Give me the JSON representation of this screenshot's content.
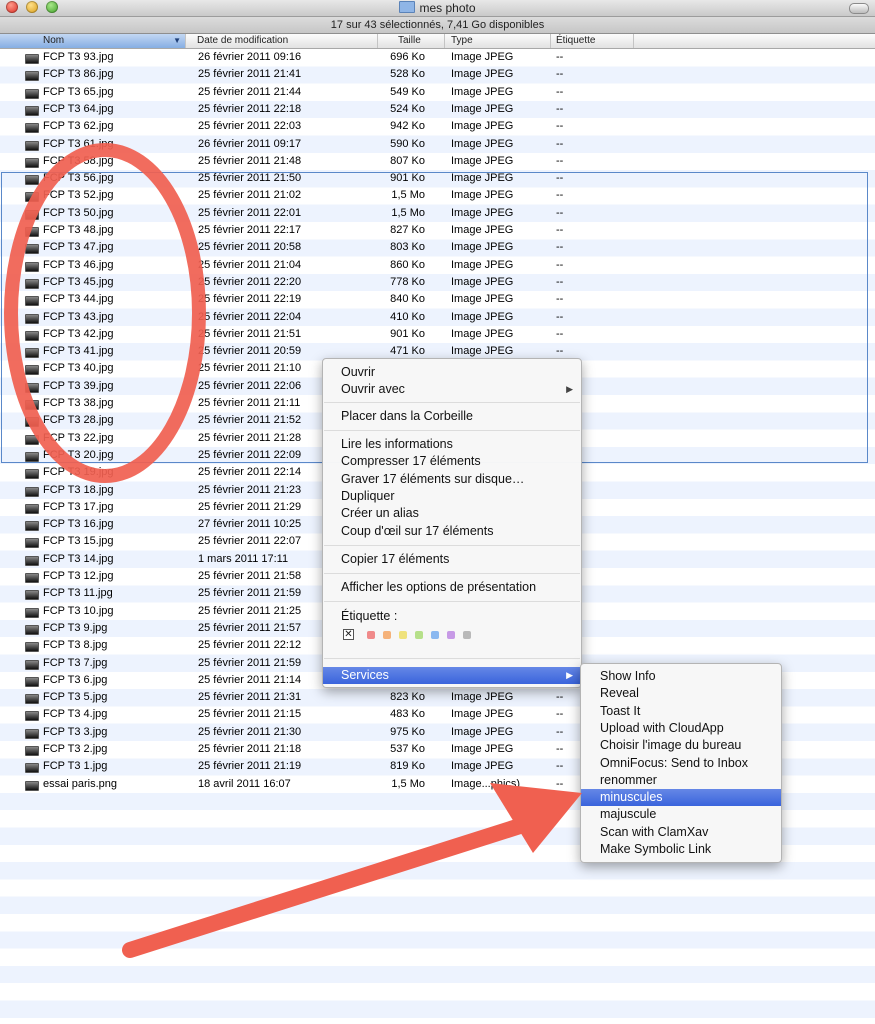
{
  "window": {
    "title": "mes photo",
    "status": "17 sur 43 sélectionnés, 7,41 Go disponibles"
  },
  "columns": {
    "name": "Nom",
    "date": "Date de modification",
    "size": "Taille",
    "type": "Type",
    "label": "Étiquette"
  },
  "files": [
    {
      "name": "FCP T3 93.jpg",
      "date": "26 février 2011 09:16",
      "size": "696 Ko",
      "type": "Image JPEG",
      "label": "--"
    },
    {
      "name": "FCP T3 86.jpg",
      "date": "25 février 2011 21:41",
      "size": "528 Ko",
      "type": "Image JPEG",
      "label": "--"
    },
    {
      "name": "FCP T3 65.jpg",
      "date": "25 février 2011 21:44",
      "size": "549 Ko",
      "type": "Image JPEG",
      "label": "--"
    },
    {
      "name": "FCP T3 64.jpg",
      "date": "25 février 2011 22:18",
      "size": "524 Ko",
      "type": "Image JPEG",
      "label": "--"
    },
    {
      "name": "FCP T3 62.jpg",
      "date": "25 février 2011 22:03",
      "size": "942 Ko",
      "type": "Image JPEG",
      "label": "--"
    },
    {
      "name": "FCP T3 61.jpg",
      "date": "26 février 2011 09:17",
      "size": "590 Ko",
      "type": "Image JPEG",
      "label": "--"
    },
    {
      "name": "FCP T3 58.jpg",
      "date": "25 février 2011 21:48",
      "size": "807 Ko",
      "type": "Image JPEG",
      "label": "--"
    },
    {
      "name": "FCP T3 56.jpg",
      "date": "25 février 2011 21:50",
      "size": "901 Ko",
      "type": "Image JPEG",
      "label": "--"
    },
    {
      "name": "FCP T3 52.jpg",
      "date": "25 février 2011 21:02",
      "size": "1,5 Mo",
      "type": "Image JPEG",
      "label": "--"
    },
    {
      "name": "FCP T3 50.jpg",
      "date": "25 février 2011 22:01",
      "size": "1,5 Mo",
      "type": "Image JPEG",
      "label": "--"
    },
    {
      "name": "FCP T3 48.jpg",
      "date": "25 février 2011 22:17",
      "size": "827 Ko",
      "type": "Image JPEG",
      "label": "--"
    },
    {
      "name": "FCP T3 47.jpg",
      "date": "25 février 2011 20:58",
      "size": "803 Ko",
      "type": "Image JPEG",
      "label": "--"
    },
    {
      "name": "FCP T3 46.jpg",
      "date": "25 février 2011 21:04",
      "size": "860 Ko",
      "type": "Image JPEG",
      "label": "--"
    },
    {
      "name": "FCP T3 45.jpg",
      "date": "25 février 2011 22:20",
      "size": "778 Ko",
      "type": "Image JPEG",
      "label": "--"
    },
    {
      "name": "FCP T3 44.jpg",
      "date": "25 février 2011 22:19",
      "size": "840 Ko",
      "type": "Image JPEG",
      "label": "--"
    },
    {
      "name": "FCP T3 43.jpg",
      "date": "25 février 2011 22:04",
      "size": "410 Ko",
      "type": "Image JPEG",
      "label": "--"
    },
    {
      "name": "FCP T3 42.jpg",
      "date": "25 février 2011 21:51",
      "size": "901 Ko",
      "type": "Image JPEG",
      "label": "--"
    },
    {
      "name": "FCP T3 41.jpg",
      "date": "25 février 2011 20:59",
      "size": "471 Ko",
      "type": "Image JPEG",
      "label": "--"
    },
    {
      "name": "FCP T3 40.jpg",
      "date": "25 février 2011 21:10",
      "size": "",
      "type": "",
      "label": ""
    },
    {
      "name": "FCP T3 39.jpg",
      "date": "25 février 2011 22:06",
      "size": "",
      "type": "",
      "label": ""
    },
    {
      "name": "FCP T3 38.jpg",
      "date": "25 février 2011 21:11",
      "size": "",
      "type": "",
      "label": ""
    },
    {
      "name": "FCP T3 28.jpg",
      "date": "25 février 2011 21:52",
      "size": "",
      "type": "",
      "label": ""
    },
    {
      "name": "FCP T3 22.jpg",
      "date": "25 février 2011 21:28",
      "size": "",
      "type": "",
      "label": ""
    },
    {
      "name": "FCP T3 20.jpg",
      "date": "25 février 2011 22:09",
      "size": "",
      "type": "",
      "label": ""
    },
    {
      "name": "FCP T3 19.jpg",
      "date": "25 février 2011 22:14",
      "size": "",
      "type": "",
      "label": ""
    },
    {
      "name": "FCP T3 18.jpg",
      "date": "25 février 2011 21:23",
      "size": "",
      "type": "",
      "label": ""
    },
    {
      "name": "FCP T3 17.jpg",
      "date": "25 février 2011 21:29",
      "size": "",
      "type": "",
      "label": ""
    },
    {
      "name": "FCP T3 16.jpg",
      "date": "27 février 2011 10:25",
      "size": "",
      "type": "",
      "label": ""
    },
    {
      "name": "FCP T3 15.jpg",
      "date": "25 février 2011 22:07",
      "size": "",
      "type": "",
      "label": ""
    },
    {
      "name": "FCP T3 14.jpg",
      "date": "1 mars 2011 17:11",
      "size": "",
      "type": "",
      "label": ""
    },
    {
      "name": "FCP T3 12.jpg",
      "date": "25 février 2011 21:58",
      "size": "",
      "type": "",
      "label": ""
    },
    {
      "name": "FCP T3 11.jpg",
      "date": "25 février 2011 21:59",
      "size": "",
      "type": "",
      "label": ""
    },
    {
      "name": "FCP T3 10.jpg",
      "date": "25 février 2011 21:25",
      "size": "",
      "type": "",
      "label": ""
    },
    {
      "name": "FCP T3 9.jpg",
      "date": "25 février 2011 21:57",
      "size": "",
      "type": "",
      "label": ""
    },
    {
      "name": "FCP T3 8.jpg",
      "date": "25 février 2011 22:12",
      "size": "",
      "type": "",
      "label": ""
    },
    {
      "name": "FCP T3 7.jpg",
      "date": "25 février 2011 21:59",
      "size": "",
      "type": "",
      "label": ""
    },
    {
      "name": "FCP T3 6.jpg",
      "date": "25 février 2011 21:14",
      "size": "",
      "type": "",
      "label": ""
    },
    {
      "name": "FCP T3 5.jpg",
      "date": "25 février 2011 21:31",
      "size": "823 Ko",
      "type": "Image JPEG",
      "label": "--"
    },
    {
      "name": "FCP T3 4.jpg",
      "date": "25 février 2011 21:15",
      "size": "483 Ko",
      "type": "Image JPEG",
      "label": "--"
    },
    {
      "name": "FCP T3 3.jpg",
      "date": "25 février 2011 21:30",
      "size": "975 Ko",
      "type": "Image JPEG",
      "label": "--"
    },
    {
      "name": "FCP T3 2.jpg",
      "date": "25 février 2011 21:18",
      "size": "537 Ko",
      "type": "Image JPEG",
      "label": "--"
    },
    {
      "name": "FCP T3 1.jpg",
      "date": "25 février 2011 21:19",
      "size": "819 Ko",
      "type": "Image JPEG",
      "label": "--"
    },
    {
      "name": "essai paris.png",
      "date": "18 avril 2011 16:07",
      "size": "1,5 Mo",
      "type": "Image...phics)",
      "label": "--"
    }
  ],
  "context_menu": {
    "open": "Ouvrir",
    "open_with": "Ouvrir avec",
    "trash": "Placer dans la Corbeille",
    "get_info": "Lire les informations",
    "compress": "Compresser 17 éléments",
    "burn": "Graver 17 éléments sur disque…",
    "duplicate": "Dupliquer",
    "alias": "Créer un alias",
    "quicklook": "Coup d'œil sur 17 éléments",
    "copy": "Copier 17 éléments",
    "view_options": "Afficher les options de présentation",
    "label_title": "Étiquette :",
    "label_none": "✕",
    "label_colors": [
      "#f08a8a",
      "#f5b27a",
      "#efe27c",
      "#b6e08a",
      "#8ab8f0",
      "#c79ae6",
      "#b9b9b9"
    ],
    "services": "Services"
  },
  "services_menu": [
    "Show Info",
    "Reveal",
    "Toast It",
    "Upload with CloudApp",
    "Choisir l'image du bureau",
    "OmniFocus: Send to Inbox",
    "renommer",
    "minuscules",
    "majuscule",
    "Scan with ClamXav",
    "Make Symbolic Link"
  ],
  "icons": {
    "submenu": "▶",
    "sort": "▼"
  },
  "colors": {
    "highlight": "#3a64dc",
    "annotation": "#f06050"
  }
}
